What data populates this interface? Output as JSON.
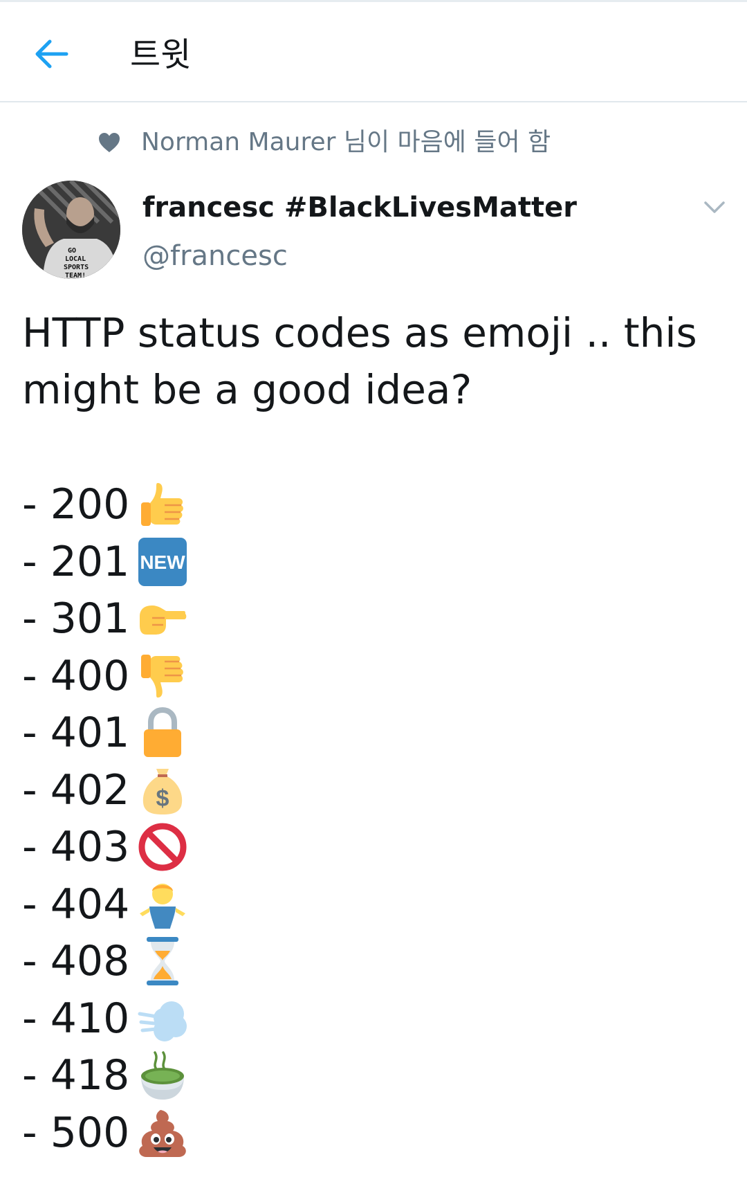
{
  "header": {
    "title": "트윗"
  },
  "social_context": {
    "text": "Norman Maurer 님이 마음에 들어 함"
  },
  "author": {
    "display_name": "francesc #BlackLivesMatter",
    "handle": "@francesc",
    "avatar_shirt_text": "GO LOCAL SPORTS TEAM!"
  },
  "tweet": {
    "text": "HTTP status codes as emoji .. this might be a good idea?",
    "codes": [
      {
        "label": "- 200",
        "icon": "thumbs-up-icon"
      },
      {
        "label": "- 201",
        "icon": "new-button-icon",
        "icon_text": "NEW"
      },
      {
        "label": "- 301",
        "icon": "pointing-right-icon"
      },
      {
        "label": "- 400",
        "icon": "thumbs-down-icon"
      },
      {
        "label": "- 401",
        "icon": "lock-icon"
      },
      {
        "label": "- 402",
        "icon": "money-bag-icon"
      },
      {
        "label": "- 403",
        "icon": "no-entry-icon"
      },
      {
        "label": "- 404",
        "icon": "shrugging-person-icon"
      },
      {
        "label": "- 408",
        "icon": "hourglass-icon"
      },
      {
        "label": "- 410",
        "icon": "dashing-away-icon"
      },
      {
        "label": "- 418",
        "icon": "teacup-icon"
      },
      {
        "label": "- 500",
        "icon": "pile-of-poo-icon"
      }
    ]
  },
  "colors": {
    "accent": "#1da1f2",
    "secondary_text": "#657786",
    "primary_text": "#14171a",
    "divider": "#e1e8ed"
  }
}
